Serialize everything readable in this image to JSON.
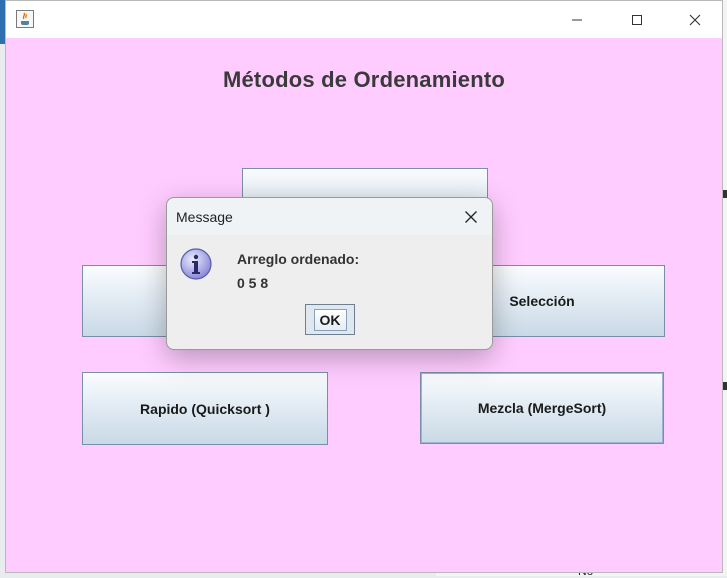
{
  "window": {
    "heading": "Métodos de Ordenamiento",
    "controls": {
      "minimize": "minimize-icon",
      "maximize": "maximize-icon",
      "close": "close-icon"
    }
  },
  "buttons": {
    "top_center": "",
    "left_middle": "",
    "seleccion": "Selección",
    "rapido": "Rapido (Quicksort )",
    "mezcla": "Mezcla (MergeSort)"
  },
  "dialog": {
    "title": "Message",
    "line1": "Arreglo ordenado:",
    "line2": "0 5 8",
    "ok_label": "OK",
    "icon": "info-icon"
  },
  "desktop": {
    "bottom_text": "Nó"
  },
  "colors": {
    "window_bg": "#ffccff",
    "button_gradient_bottom": "#c9d9e6",
    "info_icon": "#8a8ad8"
  }
}
